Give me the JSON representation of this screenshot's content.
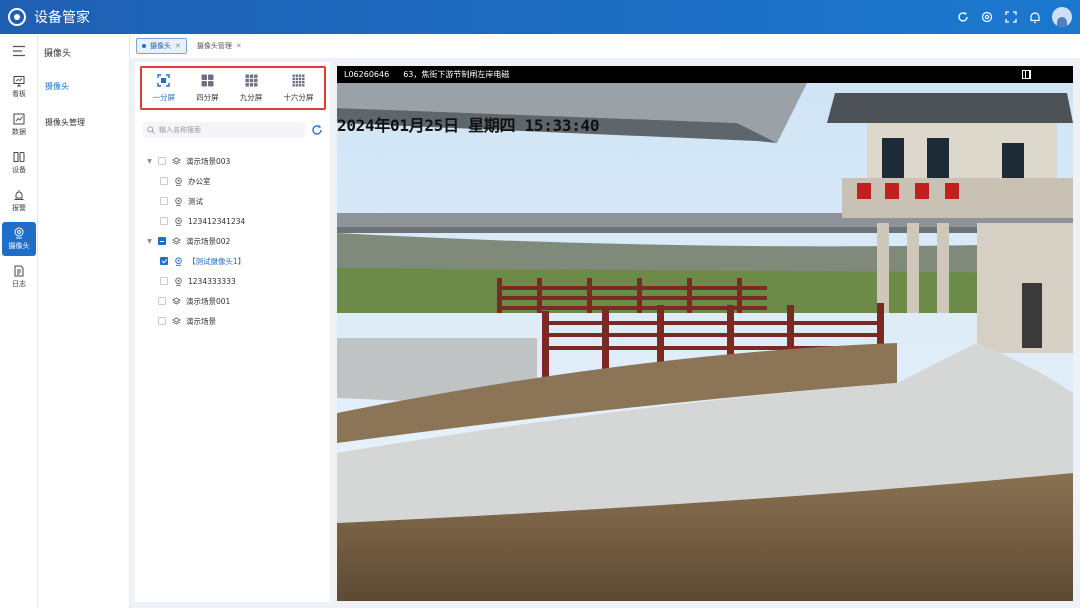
{
  "app": {
    "title": "设备管家"
  },
  "rail": {
    "items": [
      {
        "label": "看板",
        "icon": "monitor-icon"
      },
      {
        "label": "数据",
        "icon": "chart-icon"
      },
      {
        "label": "设备",
        "icon": "device-icon"
      },
      {
        "label": "报警",
        "icon": "alarm-icon"
      },
      {
        "label": "摄像头",
        "icon": "camera-icon",
        "active": true
      },
      {
        "label": "日志",
        "icon": "log-icon"
      }
    ]
  },
  "submenu": {
    "title": "摄像头",
    "items": [
      "摄像头",
      "摄像头管理"
    ]
  },
  "tabs": [
    {
      "label": "摄像头",
      "active": true
    },
    {
      "label": "摄像头管理",
      "active": false
    }
  ],
  "split": {
    "buttons": [
      {
        "label": "一分屏",
        "active": true
      },
      {
        "label": "四分屏"
      },
      {
        "label": "九分屏"
      },
      {
        "label": "十六分屏"
      }
    ]
  },
  "search": {
    "placeholder": "输入名称搜索"
  },
  "tree": [
    {
      "label": "演示场景003",
      "level": 0,
      "type": "group",
      "state": "unchecked",
      "expanded": true
    },
    {
      "label": "办公室",
      "level": 1,
      "type": "camera",
      "state": "unchecked"
    },
    {
      "label": "测试",
      "level": 1,
      "type": "camera",
      "state": "unchecked"
    },
    {
      "label": "123412341234",
      "level": 1,
      "type": "camera",
      "state": "unchecked"
    },
    {
      "label": "演示场景002",
      "level": 0,
      "type": "group",
      "state": "partial",
      "expanded": true
    },
    {
      "label": "【测试摄像头1】",
      "level": 1,
      "type": "camera",
      "state": "checked",
      "selected": true
    },
    {
      "label": "1234333333",
      "level": 1,
      "type": "camera",
      "state": "unchecked"
    },
    {
      "label": "演示场景001",
      "level": 0,
      "type": "group",
      "state": "unchecked"
    },
    {
      "label": "演示场景",
      "level": 0,
      "type": "group",
      "state": "unchecked"
    }
  ],
  "video": {
    "camera_id": "L06260646",
    "camera_name": "63，焦街下游节制闸左岸电磁",
    "osd_timestamp": "2024年01月25日 星期四 15:33:40"
  },
  "colors": {
    "brand": "#1f6ec7",
    "highlight_border": "#e23a3a"
  }
}
